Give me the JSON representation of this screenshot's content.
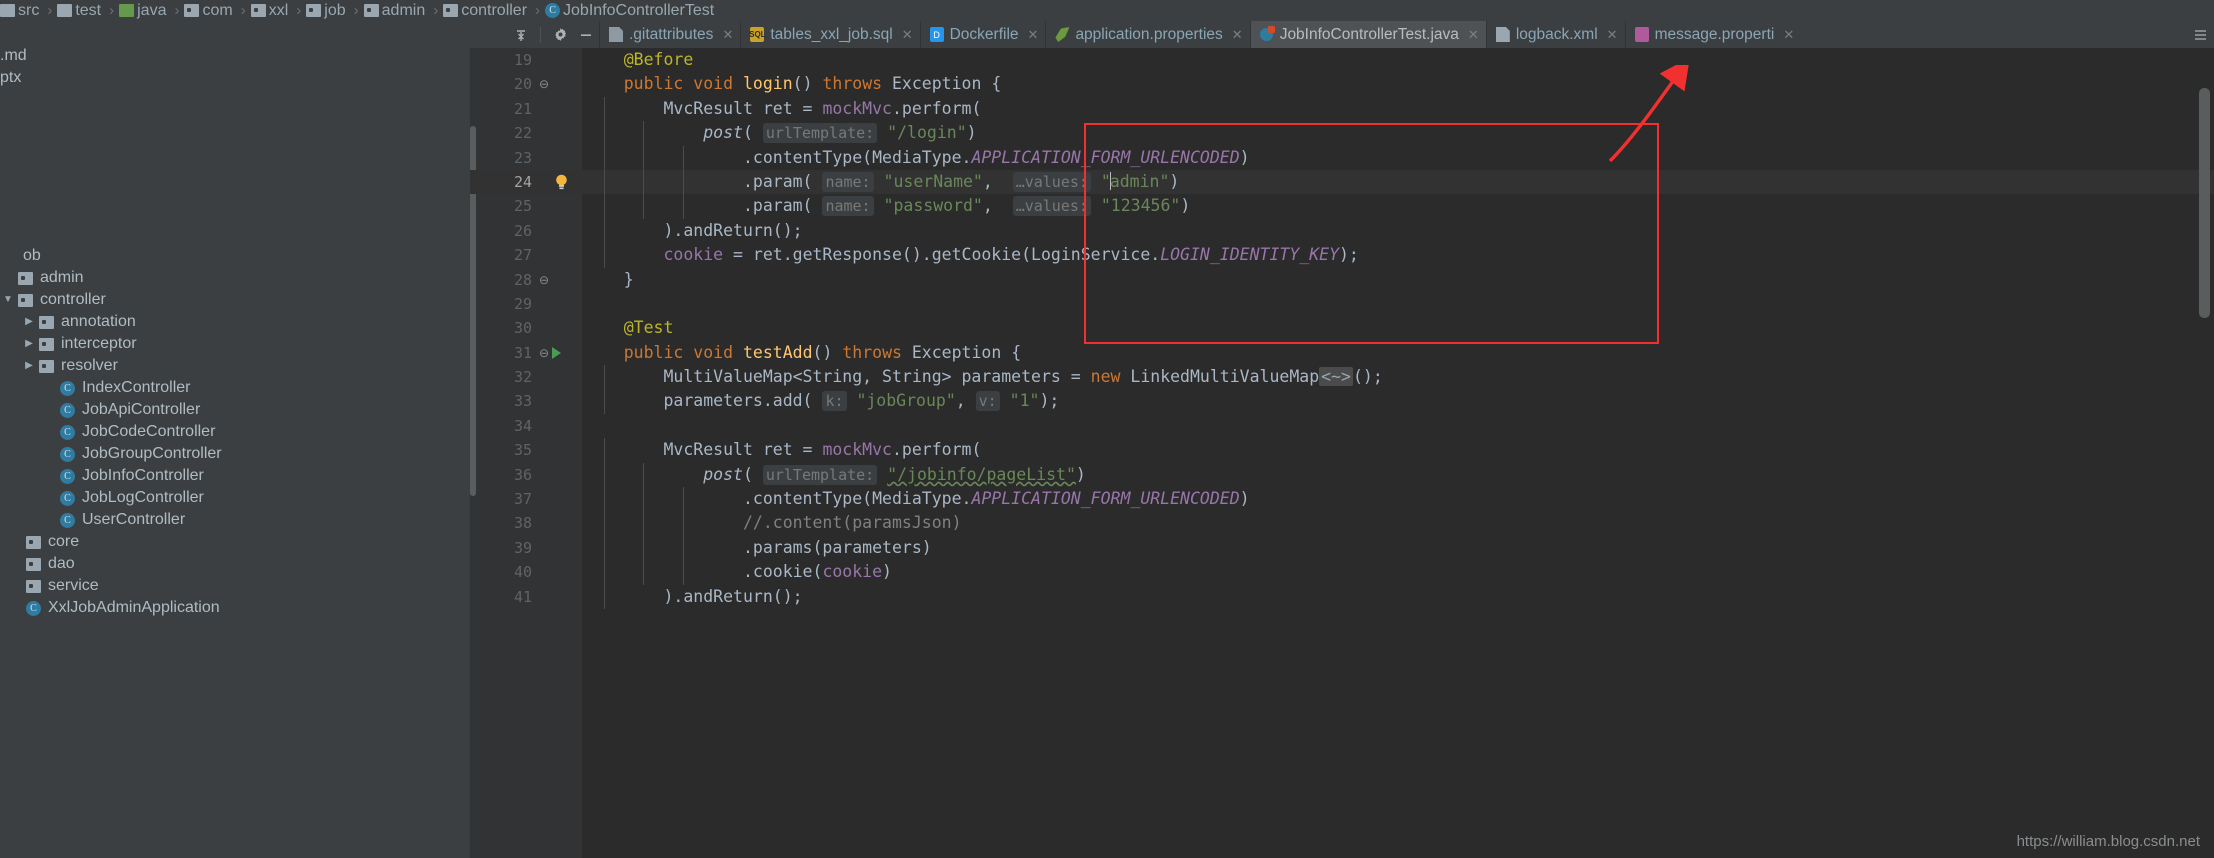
{
  "app": {
    "theme_bg": "#3c3f41",
    "editor_bg": "#2b2b2b",
    "accent_red": "#f2302f",
    "watermark": "https://william.blog.csdn.net"
  },
  "breadcrumb": {
    "items": [
      {
        "label": "src",
        "icon": "folder-plain-icon"
      },
      {
        "label": "test",
        "icon": "folder-plain-icon"
      },
      {
        "label": "java",
        "icon": "folder-green-icon"
      },
      {
        "label": "com",
        "icon": "folder-package-icon"
      },
      {
        "label": "xxl",
        "icon": "folder-package-icon"
      },
      {
        "label": "job",
        "icon": "folder-package-icon"
      },
      {
        "label": "admin",
        "icon": "folder-package-icon"
      },
      {
        "label": "controller",
        "icon": "folder-package-icon"
      },
      {
        "label": "JobInfoControllerTest",
        "icon": "class-icon"
      }
    ]
  },
  "toolbar": {
    "collapse_all_title": "Collapse All",
    "settings_title": "Settings",
    "hide_title": "Hide"
  },
  "tabs": {
    "overflow_label": "»",
    "items": [
      {
        "label": ".gitattributes",
        "icon": "file-icon",
        "selected": false
      },
      {
        "label": "tables_xxl_job.sql",
        "icon": "sql-file-icon",
        "selected": false
      },
      {
        "label": "Dockerfile",
        "icon": "docker-file-icon",
        "selected": false
      },
      {
        "label": "application.properties",
        "icon": "spring-leaf-icon",
        "selected": false
      },
      {
        "label": "JobInfoControllerTest.java",
        "icon": "java-test-class-icon",
        "selected": true
      },
      {
        "label": "logback.xml",
        "icon": "xml-file-icon",
        "selected": false
      },
      {
        "label": "message.properti",
        "icon": "properties-file-icon",
        "selected": false
      }
    ]
  },
  "project_tree": {
    "top_files": [
      {
        "label": ".md",
        "indent": 0
      },
      {
        "label": "ptx",
        "indent": 0
      }
    ],
    "items": [
      {
        "label": "ob",
        "icon": "none",
        "arrow": "",
        "indent": 0
      },
      {
        "label": "admin",
        "icon": "folder-package-icon",
        "arrow": "",
        "indent": 0
      },
      {
        "label": "controller",
        "icon": "folder-package-icon",
        "arrow": "open",
        "indent": 0
      },
      {
        "label": "annotation",
        "icon": "folder-package-icon",
        "arrow": "closed",
        "indent": 1
      },
      {
        "label": "interceptor",
        "icon": "folder-package-icon",
        "arrow": "closed",
        "indent": 1
      },
      {
        "label": "resolver",
        "icon": "folder-package-icon",
        "arrow": "closed",
        "indent": 1
      },
      {
        "label": "IndexController",
        "icon": "class-icon",
        "arrow": "",
        "indent": 2
      },
      {
        "label": "JobApiController",
        "icon": "class-icon",
        "arrow": "",
        "indent": 2
      },
      {
        "label": "JobCodeController",
        "icon": "class-icon",
        "arrow": "",
        "indent": 2
      },
      {
        "label": "JobGroupController",
        "icon": "class-icon",
        "arrow": "",
        "indent": 2
      },
      {
        "label": "JobInfoController",
        "icon": "class-icon",
        "arrow": "",
        "indent": 2
      },
      {
        "label": "JobLogController",
        "icon": "class-icon",
        "arrow": "",
        "indent": 2
      },
      {
        "label": "UserController",
        "icon": "class-icon",
        "arrow": "",
        "indent": 2
      },
      {
        "label": "core",
        "icon": "folder-package-icon",
        "arrow": "",
        "indent": -1
      },
      {
        "label": "dao",
        "icon": "folder-package-icon",
        "arrow": "",
        "indent": -1
      },
      {
        "label": "service",
        "icon": "folder-package-icon",
        "arrow": "",
        "indent": -1
      },
      {
        "label": "XxlJobAdminApplication",
        "icon": "spring-class-icon",
        "arrow": "",
        "indent": -1
      }
    ]
  },
  "editor": {
    "file": "JobInfoControllerTest.java",
    "first_visible_line": 19,
    "caret_line": 24,
    "lines": [
      {
        "n": 19,
        "indent": 1,
        "tokens": [
          {
            "t": "@Before",
            "c": "ann"
          }
        ]
      },
      {
        "n": 20,
        "indent": 1,
        "fold": "⊖",
        "tokens": [
          {
            "t": "public ",
            "c": "kw"
          },
          {
            "t": "void ",
            "c": "kw"
          },
          {
            "t": "login",
            "c": "mth"
          },
          {
            "t": "() ",
            "c": "plain"
          },
          {
            "t": "throws ",
            "c": "kw"
          },
          {
            "t": "Exception {",
            "c": "plain"
          }
        ]
      },
      {
        "n": 21,
        "indent": 2,
        "tokens": [
          {
            "t": "MvcResult ret = ",
            "c": "plain"
          },
          {
            "t": "mockMvc",
            "c": "fld"
          },
          {
            "t": ".perform(",
            "c": "plain"
          }
        ]
      },
      {
        "n": 22,
        "indent": 3,
        "tokens": [
          {
            "t": "post",
            "c": "itl"
          },
          {
            "t": "( ",
            "c": "plain"
          },
          {
            "t": "urlTemplate:",
            "c": "hint"
          },
          {
            "t": " ",
            "c": "plain"
          },
          {
            "t": "\"/login\"",
            "c": "str"
          },
          {
            "t": ")",
            "c": "plain"
          }
        ]
      },
      {
        "n": 23,
        "indent": 4,
        "tokens": [
          {
            "t": ".contentType(MediaType.",
            "c": "plain"
          },
          {
            "t": "APPLICATION_FORM_URLENCODED",
            "c": "sfld"
          },
          {
            "t": ")",
            "c": "plain"
          }
        ]
      },
      {
        "n": 24,
        "indent": 4,
        "current": true,
        "bulb": true,
        "tokens": [
          {
            "t": ".param( ",
            "c": "plain"
          },
          {
            "t": "name:",
            "c": "hint"
          },
          {
            "t": " ",
            "c": "plain"
          },
          {
            "t": "\"userName\"",
            "c": "str"
          },
          {
            "t": ",  ",
            "c": "plain"
          },
          {
            "t": "…values:",
            "c": "hint"
          },
          {
            "t": " ",
            "c": "plain"
          },
          {
            "t": "\"",
            "c": "str"
          },
          {
            "t": "CARET",
            "c": "caret"
          },
          {
            "t": "admin\"",
            "c": "str"
          },
          {
            "t": ")",
            "c": "plain"
          }
        ]
      },
      {
        "n": 25,
        "indent": 4,
        "tokens": [
          {
            "t": ".param( ",
            "c": "plain"
          },
          {
            "t": "name:",
            "c": "hint"
          },
          {
            "t": " ",
            "c": "plain"
          },
          {
            "t": "\"password\"",
            "c": "str"
          },
          {
            "t": ",  ",
            "c": "plain"
          },
          {
            "t": "…values:",
            "c": "hint"
          },
          {
            "t": " ",
            "c": "plain"
          },
          {
            "t": "\"123456\"",
            "c": "str"
          },
          {
            "t": ")",
            "c": "plain"
          }
        ]
      },
      {
        "n": 26,
        "indent": 2,
        "tokens": [
          {
            "t": ").andReturn();",
            "c": "plain"
          }
        ]
      },
      {
        "n": 27,
        "indent": 2,
        "tokens": [
          {
            "t": "cookie",
            "c": "fld"
          },
          {
            "t": " = ret.getResponse().getCookie(LoginService.",
            "c": "plain"
          },
          {
            "t": "LOGIN_IDENTITY_KEY",
            "c": "sfld"
          },
          {
            "t": ");",
            "c": "plain"
          }
        ]
      },
      {
        "n": 28,
        "indent": 1,
        "fold": "⊖",
        "tokens": [
          {
            "t": "}",
            "c": "plain"
          }
        ]
      },
      {
        "n": 29,
        "indent": 0,
        "tokens": []
      },
      {
        "n": 30,
        "indent": 1,
        "tokens": [
          {
            "t": "@Test",
            "c": "ann"
          }
        ]
      },
      {
        "n": 31,
        "indent": 1,
        "fold": "⊖",
        "run": true,
        "tokens": [
          {
            "t": "public ",
            "c": "kw"
          },
          {
            "t": "void ",
            "c": "kw"
          },
          {
            "t": "testAdd",
            "c": "mth"
          },
          {
            "t": "() ",
            "c": "plain"
          },
          {
            "t": "throws ",
            "c": "kw"
          },
          {
            "t": "Exception {",
            "c": "plain"
          }
        ]
      },
      {
        "n": 32,
        "indent": 2,
        "tokens": [
          {
            "t": "MultiValueMap<String, String> parameters = ",
            "c": "plain"
          },
          {
            "t": "new ",
            "c": "kw"
          },
          {
            "t": "LinkedMultiValueMap",
            "c": "plain"
          },
          {
            "t": "<∼>",
            "c": "fold-chip"
          },
          {
            "t": "();",
            "c": "plain"
          }
        ]
      },
      {
        "n": 33,
        "indent": 2,
        "tokens": [
          {
            "t": "parameters.add( ",
            "c": "plain"
          },
          {
            "t": "k:",
            "c": "hint"
          },
          {
            "t": " ",
            "c": "plain"
          },
          {
            "t": "\"jobGroup\"",
            "c": "str"
          },
          {
            "t": ", ",
            "c": "plain"
          },
          {
            "t": "v:",
            "c": "hint"
          },
          {
            "t": " ",
            "c": "plain"
          },
          {
            "t": "\"1\"",
            "c": "str"
          },
          {
            "t": ");",
            "c": "plain"
          }
        ]
      },
      {
        "n": 34,
        "indent": 0,
        "tokens": []
      },
      {
        "n": 35,
        "indent": 2,
        "tokens": [
          {
            "t": "MvcResult ret = ",
            "c": "plain"
          },
          {
            "t": "mockMvc",
            "c": "fld"
          },
          {
            "t": ".perform(",
            "c": "plain"
          }
        ]
      },
      {
        "n": 36,
        "indent": 3,
        "tokens": [
          {
            "t": "post",
            "c": "itl"
          },
          {
            "t": "( ",
            "c": "plain"
          },
          {
            "t": "urlTemplate:",
            "c": "hint"
          },
          {
            "t": " ",
            "c": "plain"
          },
          {
            "t": "\"/jobinfo/pageList\"",
            "c": "str-sq"
          },
          {
            "t": ")",
            "c": "plain"
          }
        ]
      },
      {
        "n": 37,
        "indent": 4,
        "tokens": [
          {
            "t": ".contentType(MediaType.",
            "c": "plain"
          },
          {
            "t": "APPLICATION_FORM_URLENCODED",
            "c": "sfld"
          },
          {
            "t": ")",
            "c": "plain"
          }
        ]
      },
      {
        "n": 38,
        "indent": 4,
        "tokens": [
          {
            "t": "//.content(paramsJson)",
            "c": "cmt"
          }
        ]
      },
      {
        "n": 39,
        "indent": 4,
        "tokens": [
          {
            "t": ".params(parameters)",
            "c": "plain"
          }
        ]
      },
      {
        "n": 40,
        "indent": 4,
        "tokens": [
          {
            "t": ".cookie(",
            "c": "plain"
          },
          {
            "t": "cookie",
            "c": "fld"
          },
          {
            "t": ")",
            "c": "plain"
          }
        ]
      },
      {
        "n": 41,
        "indent": 2,
        "tokens": [
          {
            "t": ").andReturn();",
            "c": "plain"
          }
        ]
      }
    ]
  },
  "annotation": {
    "box_color": "#f2302f",
    "arrow_color": "#f2302f",
    "note": "red rectangle highlighting login setup block with arrow to selected tab"
  }
}
